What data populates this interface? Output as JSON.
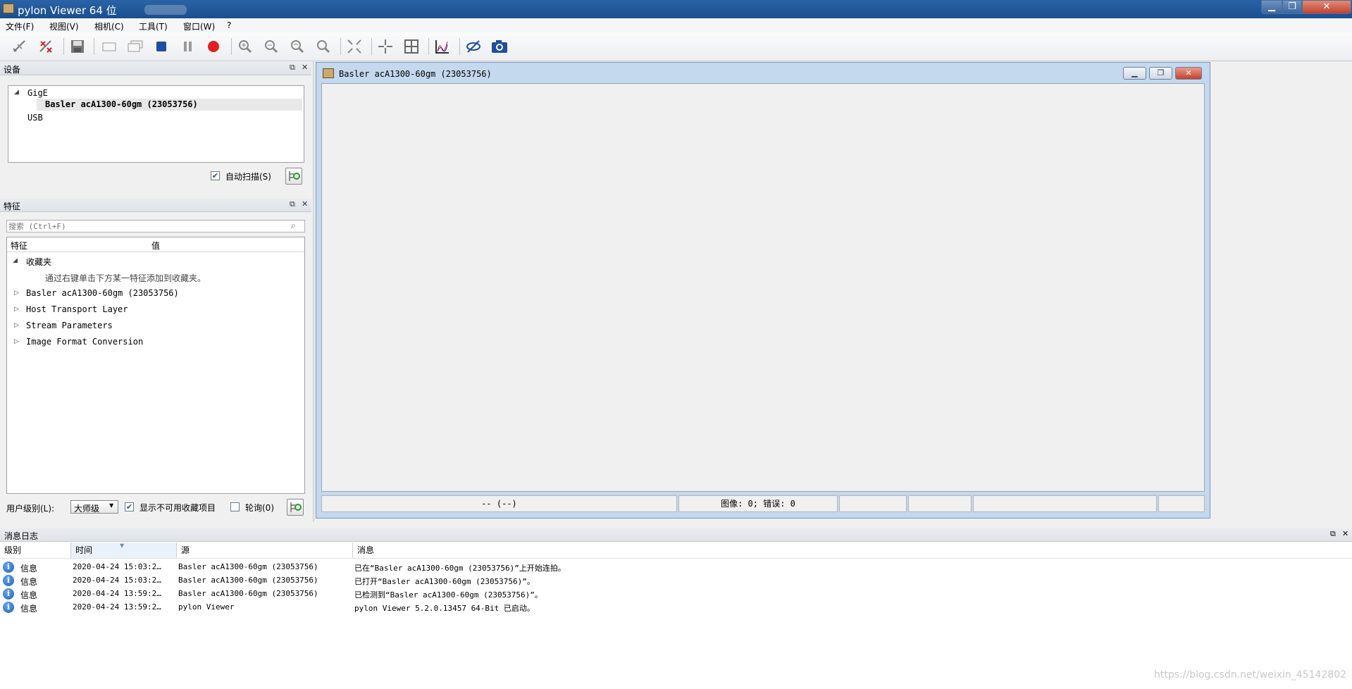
{
  "window": {
    "title": "pylon Viewer 64 位",
    "minimize": "▁",
    "maximize": "❐",
    "close": "✕"
  },
  "menu": [
    "文件(F)",
    "视图(V)",
    "相机(C)",
    "工具(T)",
    "窗口(W)",
    "?"
  ],
  "toolbar": {
    "icons": [
      "open-camera-icon",
      "close-camera-icon",
      "save-icon",
      "single-shot-icon",
      "continuous-shot-icon",
      "stop-icon",
      "pause-icon",
      "record-icon",
      "zoom-in-icon",
      "zoom-out-icon",
      "zoom-fit-icon",
      "zoom-100-icon",
      "fit-window-icon",
      "crosshair-icon",
      "grid-icon",
      "histogram-icon",
      "pixel-inspect-icon",
      "camera-snapshot-icon"
    ]
  },
  "devices_panel": {
    "title": "设备",
    "tree": {
      "group1": "GigE",
      "device": "Basler acA1300-60gm (23053756)",
      "group2": "USB"
    },
    "auto_scan_label": "自动扫描(S)",
    "auto_scan_checked": true
  },
  "features_panel": {
    "title": "特征",
    "search_placeholder": "搜索 (Ctrl+F)",
    "col_feature": "特征",
    "col_value": "值",
    "favorites": "收藏夹",
    "favorites_hint": "通过右键单击下方某一特征添加到收藏夹。",
    "nodes": [
      "Basler acA1300-60gm (23053756)",
      "Host Transport Layer",
      "Stream Parameters",
      "Image Format Conversion"
    ],
    "user_level_label": "用户级别(L):",
    "user_level_value": "大师级",
    "show_unavailable_label": "显示不可用收藏项目",
    "show_unavailable_checked": true,
    "polling_label": "轮询(0)",
    "polling_checked": false
  },
  "image_window": {
    "title": "Basler acA1300-60gm (23053756)",
    "status_left": "-- (--)",
    "status_images": "图像: 0; 错误: 0"
  },
  "log": {
    "title": "消息日志",
    "columns": [
      "级别",
      "时间",
      "源",
      "消息"
    ],
    "rows": [
      {
        "level": "信息",
        "time": "2020-04-24 15:03:2…",
        "source": "Basler acA1300-60gm (23053756)",
        "message": "已在“Basler acA1300-60gm (23053756)”上开始连拍。"
      },
      {
        "level": "信息",
        "time": "2020-04-24 15:03:2…",
        "source": "Basler acA1300-60gm (23053756)",
        "message": "已打开“Basler acA1300-60gm (23053756)”。"
      },
      {
        "level": "信息",
        "time": "2020-04-24 13:59:2…",
        "source": "Basler acA1300-60gm (23053756)",
        "message": "已检测到“Basler acA1300-60gm (23053756)”。"
      },
      {
        "level": "信息",
        "time": "2020-04-24 13:59:2…",
        "source": "pylon Viewer",
        "message": "pylon Viewer 5.2.0.13457 64-Bit 已启动。"
      }
    ]
  },
  "watermark": "https://blog.csdn.net/weixin_45142802"
}
